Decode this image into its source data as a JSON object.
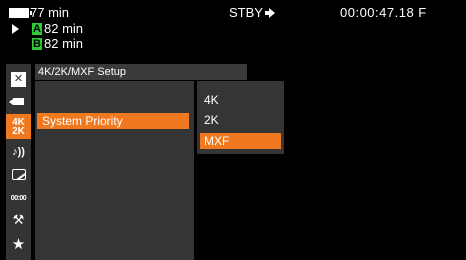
{
  "status": {
    "battery_label": "ACCU",
    "battery_time": "77 min",
    "slot_a_label": "A",
    "slot_a_time": "82 min",
    "slot_b_label": "B",
    "slot_b_time": "82 min",
    "mode": "STBY",
    "timecode": "00:00:47.18 F"
  },
  "sidebar": {
    "icons": [
      "close-icon",
      "camera-icon",
      "4k-2k-icon",
      "audio-icon",
      "display-icon",
      "timecode-icon",
      "wrench-icon",
      "star-icon"
    ],
    "selected_top": "4K",
    "selected_bottom": "2K",
    "audio_glyph": "♪))",
    "tc_glyph": "00:00",
    "wrench_glyph": "⚒",
    "star_glyph": "★",
    "close_glyph": "✕"
  },
  "menu": {
    "title": "4K/2K/MXF Setup",
    "selected_item": "System Priority"
  },
  "submenu": {
    "options": [
      "4K",
      "2K",
      "MXF"
    ],
    "selected": "MXF"
  },
  "colors": {
    "accent": "#f0781e",
    "panel": "#353535",
    "slot_badge": "#2fc93a"
  }
}
